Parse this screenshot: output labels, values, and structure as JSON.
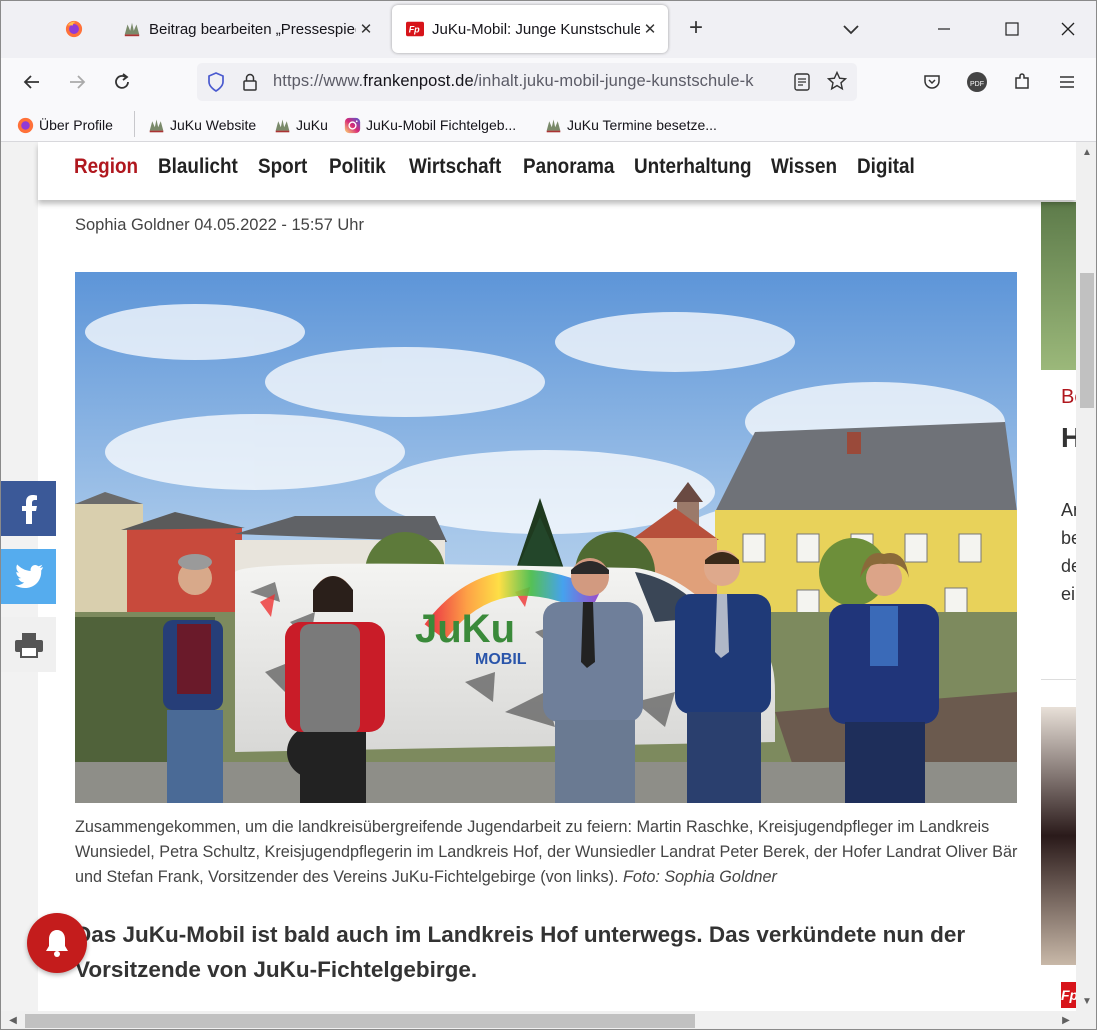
{
  "tabs": [
    {
      "label": ""
    },
    {
      "label": "Beitrag bearbeiten „Pressespiegel“ ‹ JuKu"
    },
    {
      "label": "JuKu-Mobil: Junge Kunstschule Hof"
    }
  ],
  "nav": {
    "url_prefix": "https://www.",
    "url_host": "frankenpost.de",
    "url_path": "/inhalt.juku-mobil-junge-kunstschule-k"
  },
  "bookmarks": [
    {
      "label": "Über Profile",
      "icon": "firefox-icon"
    },
    {
      "label": "JuKu Website",
      "icon": "juku-logo-icon"
    },
    {
      "label": "JuKu",
      "icon": "juku-logo-icon"
    },
    {
      "label": "JuKu-Mobil Fichtelgeb...",
      "icon": "instagram-icon"
    },
    {
      "label": "JuKu Termine besetze...",
      "icon": "juku-logo-icon"
    }
  ],
  "menu": [
    "Region",
    "Blaulicht",
    "Sport",
    "Politik",
    "Wirtschaft",
    "Panorama",
    "Unterhaltung",
    "Wissen",
    "Digital"
  ],
  "article": {
    "byline": "Sophia Goldner 04.05.2022 - 15:57 Uhr",
    "caption": "Zusammengekommen, um die landkreisübergreifende Jugendarbeit zu feiern: Martin Raschke, Kreisjugendpfleger im Landkreis Wunsiedel, Petra Schultz, Kreisjugendpflegerin im Landkreis Hof, der Wunsiedler Landrat Peter Berek, der Hofer Landrat Oliver Bär und Stefan Frank, Vorsitzender des Vereins JuKu-Fichtelgebirge (von links).",
    "caption_credit": "Foto: Sophia Goldner",
    "lead": "Das JuKu-Mobil ist bald auch im Landkreis Hof unterwegs. Das verkündete nun der Vorsitzende von JuKu-Fichtelgebirge.",
    "van_text": "JuKu",
    "van_sub": "MOBIL"
  },
  "sidebar": {
    "teaser_kicker": "Be",
    "teaser_title": "H",
    "teaser_lines": [
      "An",
      "be",
      "de",
      "ei"
    ],
    "logo_text": "Fp"
  },
  "colors": {
    "brand_red": "#b0171e",
    "facebook": "#3b5998",
    "twitter": "#55acee",
    "bell": "#c41c1c"
  }
}
